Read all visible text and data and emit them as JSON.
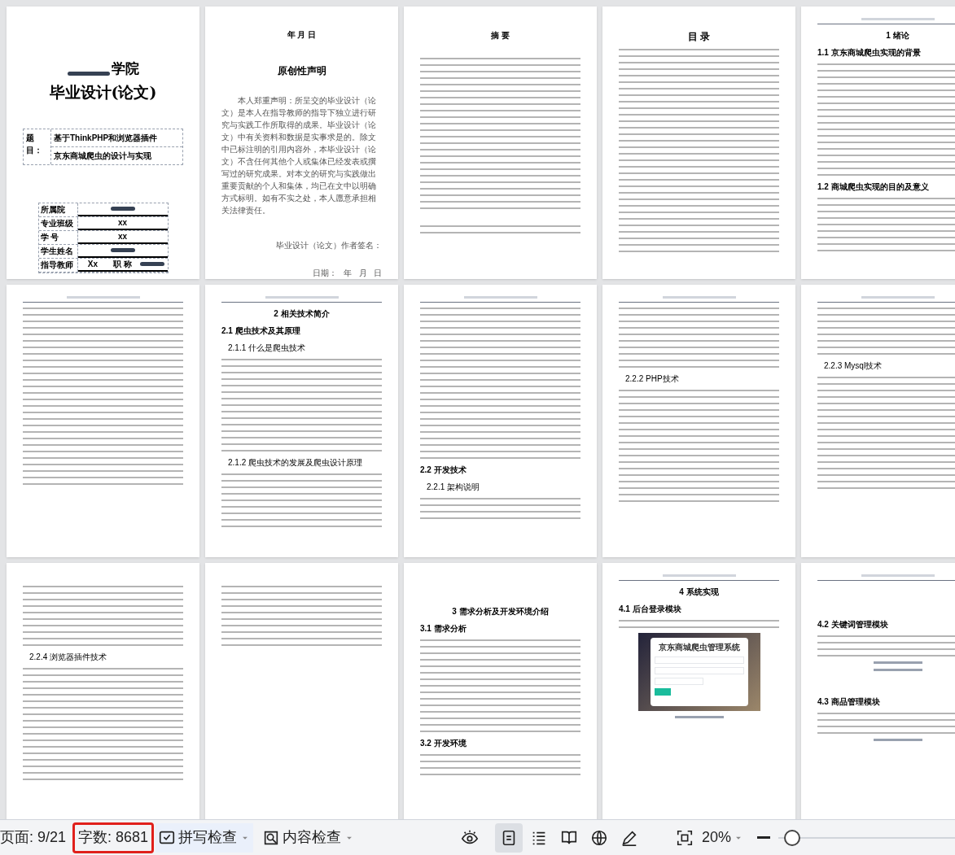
{
  "pages": [
    {
      "header": false,
      "blocks": [
        {
          "kind": "biggap"
        },
        {
          "kind": "school",
          "text": "学院"
        },
        {
          "kind": "cover-title",
          "text": "毕业设计(论文)"
        },
        {
          "kind": "gap"
        },
        {
          "kind": "topic-table",
          "label": "题目：",
          "lines": [
            "基于ThinkPHP和浏览器插件",
            "京东商城爬虫的设计与实现"
          ]
        },
        {
          "kind": "biggap"
        },
        {
          "kind": "info-table",
          "rows": [
            {
              "label": "所属院",
              "values": [
                {
                  "kind": "redacted"
                }
              ]
            },
            {
              "label": "专业班级",
              "values": [
                {
                  "kind": "text",
                  "text": "xx"
                }
              ]
            },
            {
              "label": "学 号",
              "values": [
                {
                  "kind": "text",
                  "text": "xx"
                }
              ]
            },
            {
              "label": "学生姓名",
              "values": [
                {
                  "kind": "redacted"
                }
              ]
            },
            {
              "label": "指导教师",
              "values": [
                {
                  "kind": "text",
                  "text": "Xx"
                },
                {
                  "kind": "text",
                  "text": "职 称"
                },
                {
                  "kind": "redacted"
                }
              ]
            }
          ]
        }
      ]
    },
    {
      "header": false,
      "blocks": [
        {
          "kind": "chapter",
          "text": "年 月 日"
        },
        {
          "kind": "gap"
        },
        {
          "kind": "title",
          "text": "原创性声明"
        },
        {
          "kind": "smallgap"
        },
        {
          "kind": "statement",
          "text": "本人郑重声明：所呈交的毕业设计（论文）是本人在指导教师的指导下独立进行研究与实践工作所取得的成果。毕业设计（论文）中有关资料和数据是实事求是的。除文中已标注明的引用内容外，本毕业设计（论文）不含任何其他个人或集体已经发表或撰写过的研究成果。对本文的研究与实践做出重要贡献的个人和集体，均已在文中以明确方式标明。如有不实之处，本人愿意承担相关法律责任。"
        },
        {
          "kind": "gap"
        },
        {
          "kind": "right-text",
          "text": "毕业设计（论文）作者签名："
        },
        {
          "kind": "smallgap"
        },
        {
          "kind": "right-text",
          "text": "日期：   年   月   日"
        }
      ]
    },
    {
      "header": false,
      "blocks": [
        {
          "kind": "chapter",
          "text": "摘 要"
        },
        {
          "kind": "smallgap"
        },
        {
          "kind": "paragraph"
        },
        {
          "kind": "longparagraph"
        },
        {
          "kind": "longparagraph"
        },
        {
          "kind": "smallgap"
        },
        {
          "kind": "line"
        }
      ]
    },
    {
      "header": false,
      "blocks": [
        {
          "kind": "title",
          "text": "目 录"
        },
        {
          "kind": "toc"
        }
      ]
    },
    {
      "header": true,
      "blocks": [
        {
          "kind": "chapter",
          "text": "1 绪论"
        },
        {
          "kind": "section",
          "text": "1.1 京东商城爬虫实现的背景"
        },
        {
          "kind": "paragraph"
        },
        {
          "kind": "paragraph"
        },
        {
          "kind": "paragraph"
        },
        {
          "kind": "section",
          "text": "1.2 商城爬虫实现的目的及意义"
        },
        {
          "kind": "longparagraph"
        }
      ]
    },
    {
      "header": true,
      "blocks": [
        {
          "kind": "shortparagraph"
        },
        {
          "kind": "longparagraph"
        },
        {
          "kind": "longparagraph"
        },
        {
          "kind": "paragraph"
        }
      ]
    },
    {
      "header": true,
      "blocks": [
        {
          "kind": "chapter",
          "text": "2 相关技术简介"
        },
        {
          "kind": "section",
          "text": "2.1 爬虫技术及其原理"
        },
        {
          "kind": "subsection",
          "text": "2.1.1 什么是爬虫技术"
        },
        {
          "kind": "longparagraph"
        },
        {
          "kind": "paragraph"
        },
        {
          "kind": "subsection",
          "text": "2.1.2 爬虫技术的发展及爬虫设计原理"
        },
        {
          "kind": "longparagraph"
        }
      ]
    },
    {
      "header": true,
      "blocks": [
        {
          "kind": "longparagraph"
        },
        {
          "kind": "longparagraph"
        },
        {
          "kind": "paragraph"
        },
        {
          "kind": "section",
          "text": "2.2 开发技术"
        },
        {
          "kind": "subsection",
          "text": "2.2.1 架构说明"
        },
        {
          "kind": "shortparagraph"
        }
      ]
    },
    {
      "header": true,
      "blocks": [
        {
          "kind": "paragraph"
        },
        {
          "kind": "shortparagraph"
        },
        {
          "kind": "subsection",
          "text": "2.2.2 PHP技术"
        },
        {
          "kind": "longparagraph"
        },
        {
          "kind": "longparagraph"
        }
      ]
    },
    {
      "header": true,
      "blocks": [
        {
          "kind": "shortparagraph"
        },
        {
          "kind": "shortparagraph"
        },
        {
          "kind": "subsection",
          "text": "2.2.3 Mysql技术"
        },
        {
          "kind": "longparagraph"
        },
        {
          "kind": "longparagraph"
        }
      ]
    },
    {
      "header": false,
      "blocks": [
        {
          "kind": "paragraph"
        },
        {
          "kind": "shortparagraph"
        },
        {
          "kind": "subsection",
          "text": "2.2.4 浏览器插件技术"
        },
        {
          "kind": "longparagraph"
        },
        {
          "kind": "longparagraph"
        }
      ]
    },
    {
      "header": false,
      "blocks": [
        {
          "kind": "shortparagraph"
        },
        {
          "kind": "paragraph"
        }
      ]
    },
    {
      "header": false,
      "blocks": [
        {
          "kind": "gap"
        },
        {
          "kind": "chapter",
          "text": "3 需求分析及开发环境介绍"
        },
        {
          "kind": "section",
          "text": "3.1 需求分析"
        },
        {
          "kind": "longparagraph"
        },
        {
          "kind": "paragraph"
        },
        {
          "kind": "section",
          "text": "3.2 开发环境"
        },
        {
          "kind": "shortparagraph"
        }
      ]
    },
    {
      "header": true,
      "blocks": [
        {
          "kind": "chapter",
          "text": "4 系统实现"
        },
        {
          "kind": "section",
          "text": "4.1 后台登录模块"
        },
        {
          "kind": "line"
        },
        {
          "kind": "figure",
          "title": "京东商城爬虫管理系统"
        },
        {
          "kind": "caption"
        }
      ]
    },
    {
      "header": true,
      "blocks": [
        {
          "kind": "biggap"
        },
        {
          "kind": "section",
          "text": "4.2 关键词管理模块"
        },
        {
          "kind": "shortparagraph"
        },
        {
          "kind": "caption"
        },
        {
          "kind": "caption"
        },
        {
          "kind": "gap"
        },
        {
          "kind": "section",
          "text": "4.3 商品管理模块"
        },
        {
          "kind": "shortparagraph"
        },
        {
          "kind": "caption"
        }
      ]
    }
  ],
  "status_bar": {
    "page": "页面: 9/21",
    "word_count": "字数: 8681",
    "spell_check": "拼写检查",
    "content_check": "内容检查",
    "views": [
      {
        "kind": "read",
        "selected": false
      },
      {
        "kind": "page",
        "selected": true
      },
      {
        "kind": "outline",
        "selected": false
      },
      {
        "kind": "book",
        "selected": false
      },
      {
        "kind": "web",
        "selected": false
      },
      {
        "kind": "write",
        "selected": false
      }
    ],
    "zoom": "20%",
    "zoom_slider": {
      "level": 0.08
    }
  }
}
